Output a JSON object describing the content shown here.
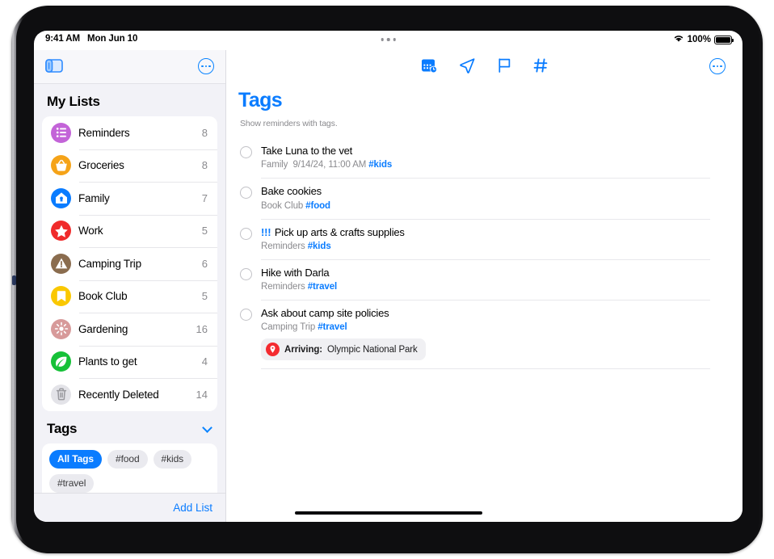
{
  "status_bar": {
    "time": "9:41 AM",
    "date": "Mon Jun 10",
    "battery_percent": "100%",
    "wifi_icon": "wifi-icon",
    "battery_icon": "battery-full-icon",
    "multitask_handle": "multitasking-handle-icon"
  },
  "sidebar": {
    "toggle_icon": "sidebar-toggle-icon",
    "more_icon": "more-circle-icon",
    "my_lists_title": "My Lists",
    "lists": [
      {
        "label": "Reminders",
        "count": "8",
        "icon": "list-bullet-icon",
        "color": "#c364d8"
      },
      {
        "label": "Groceries",
        "count": "8",
        "icon": "basket-icon",
        "color": "#f5a318"
      },
      {
        "label": "Family",
        "count": "7",
        "icon": "house-icon",
        "color": "#0a7cff"
      },
      {
        "label": "Work",
        "count": "5",
        "icon": "star-icon",
        "color": "#f02b2b"
      },
      {
        "label": "Camping Trip",
        "count": "6",
        "icon": "tent-icon",
        "color": "#8a6c4e"
      },
      {
        "label": "Book Club",
        "count": "5",
        "icon": "bookmark-icon",
        "color": "#fac800"
      },
      {
        "label": "Gardening",
        "count": "16",
        "icon": "flower-icon",
        "color": "#d79a9a"
      },
      {
        "label": "Plants to get",
        "count": "4",
        "icon": "leaf-icon",
        "color": "#16c138"
      },
      {
        "label": "Recently Deleted",
        "count": "14",
        "icon": "trash-icon",
        "color": "#e3e3e8"
      }
    ],
    "tags_title": "Tags",
    "tags_chevron_icon": "chevron-down-icon",
    "tag_chips": [
      {
        "label": "All Tags",
        "active": true
      },
      {
        "label": "#food",
        "active": false
      },
      {
        "label": "#kids",
        "active": false
      },
      {
        "label": "#travel",
        "active": false
      }
    ],
    "add_list_label": "Add List"
  },
  "main": {
    "toolbar_icons": [
      "calendar-clock-icon",
      "location-arrow-icon",
      "flag-icon",
      "hash-icon"
    ],
    "more_icon": "more-circle-icon",
    "title": "Tags",
    "subtitle": "Show reminders with tags.",
    "reminders": [
      {
        "priority": "",
        "title": "Take Luna to the vet",
        "list": "Family",
        "date": "9/14/24, 11:00 AM",
        "tag": "#kids",
        "badge": null
      },
      {
        "priority": "",
        "title": "Bake cookies",
        "list": "Book Club",
        "date": "",
        "tag": "#food",
        "badge": null
      },
      {
        "priority": "!!!",
        "title": "Pick up arts & crafts supplies",
        "list": "Reminders",
        "date": "",
        "tag": "#kids",
        "badge": null
      },
      {
        "priority": "",
        "title": "Hike with Darla",
        "list": "Reminders",
        "date": "",
        "tag": "#travel",
        "badge": null
      },
      {
        "priority": "",
        "title": "Ask about camp site policies",
        "list": "Camping Trip",
        "date": "",
        "tag": "#travel",
        "badge": {
          "icon": "location-pin-icon",
          "prefix": "Arriving",
          "value": "Olympic National Park"
        }
      }
    ]
  },
  "colors": {
    "accent_blue": "#0a7cff",
    "sidebar_bg": "#f2f2f7",
    "badge_red": "#f42b30"
  }
}
